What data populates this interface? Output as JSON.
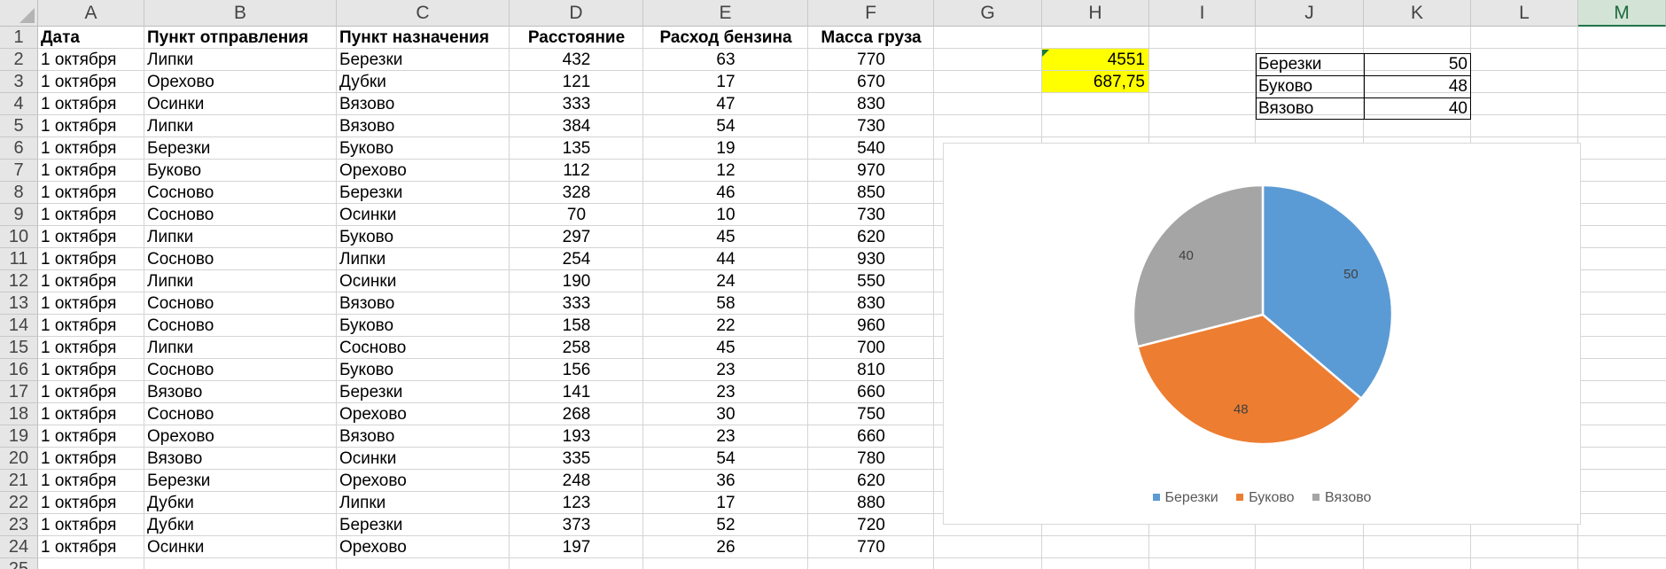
{
  "columns": [
    "A",
    "B",
    "C",
    "D",
    "E",
    "F",
    "G",
    "H",
    "I",
    "J",
    "K",
    "L",
    "M"
  ],
  "selected_column": "M",
  "rows": [
    "1",
    "2",
    "3",
    "4",
    "5",
    "6",
    "7",
    "8",
    "9",
    "10",
    "11",
    "12",
    "13",
    "14",
    "15",
    "16",
    "17",
    "18",
    "19",
    "20",
    "21",
    "22",
    "23",
    "24",
    "25"
  ],
  "header_row": [
    "Дата",
    "Пункт отправления",
    "Пункт назначения",
    "Расстояние",
    "Расход бензина",
    "Масса груза"
  ],
  "data_rows": [
    [
      "1 октября",
      "Липки",
      "Березки",
      "432",
      "63",
      "770"
    ],
    [
      "1 октября",
      "Орехово",
      "Дубки",
      "121",
      "17",
      "670"
    ],
    [
      "1 октября",
      "Осинки",
      "Вязово",
      "333",
      "47",
      "830"
    ],
    [
      "1 октября",
      "Липки",
      "Вязово",
      "384",
      "54",
      "730"
    ],
    [
      "1 октября",
      "Березки",
      "Буково",
      "135",
      "19",
      "540"
    ],
    [
      "1 октября",
      "Буково",
      "Орехово",
      "112",
      "12",
      "970"
    ],
    [
      "1 октября",
      "Сосново",
      "Березки",
      "328",
      "46",
      "850"
    ],
    [
      "1 октября",
      "Сосново",
      "Осинки",
      "70",
      "10",
      "730"
    ],
    [
      "1 октября",
      "Липки",
      "Буково",
      "297",
      "45",
      "620"
    ],
    [
      "1 октября",
      "Сосново",
      "Липки",
      "254",
      "44",
      "930"
    ],
    [
      "1 октября",
      "Липки",
      "Осинки",
      "190",
      "24",
      "550"
    ],
    [
      "1 октября",
      "Сосново",
      "Вязово",
      "333",
      "58",
      "830"
    ],
    [
      "1 октября",
      "Сосново",
      "Буково",
      "158",
      "22",
      "960"
    ],
    [
      "1 октября",
      "Липки",
      "Сосново",
      "258",
      "45",
      "700"
    ],
    [
      "1 октября",
      "Сосново",
      "Буково",
      "156",
      "23",
      "810"
    ],
    [
      "1 октября",
      "Вязово",
      "Березки",
      "141",
      "23",
      "660"
    ],
    [
      "1 октября",
      "Сосново",
      "Орехово",
      "268",
      "30",
      "750"
    ],
    [
      "1 октября",
      "Орехово",
      "Вязово",
      "193",
      "23",
      "660"
    ],
    [
      "1 октября",
      "Вязово",
      "Осинки",
      "335",
      "54",
      "780"
    ],
    [
      "1 октября",
      "Березки",
      "Орехово",
      "248",
      "36",
      "620"
    ],
    [
      "1 октября",
      "Дубки",
      "Липки",
      "123",
      "17",
      "880"
    ],
    [
      "1 октября",
      "Дубки",
      "Березки",
      "373",
      "52",
      "720"
    ],
    [
      "1 октября",
      "Осинки",
      "Орехово",
      "197",
      "26",
      "770"
    ]
  ],
  "h_values": [
    "4551",
    "687,75"
  ],
  "summary_table": [
    [
      "Березки",
      "50"
    ],
    [
      "Буково",
      "48"
    ],
    [
      "Вязово",
      "40"
    ]
  ],
  "chart_data": {
    "type": "pie",
    "title": "",
    "categories": [
      "Березки",
      "Буково",
      "Вязово"
    ],
    "values": [
      50,
      48,
      40
    ],
    "data_labels": [
      "50",
      "48",
      "40"
    ],
    "colors": [
      "#5b9bd5",
      "#ed7d31",
      "#a5a5a5"
    ],
    "legend": "bottom"
  }
}
